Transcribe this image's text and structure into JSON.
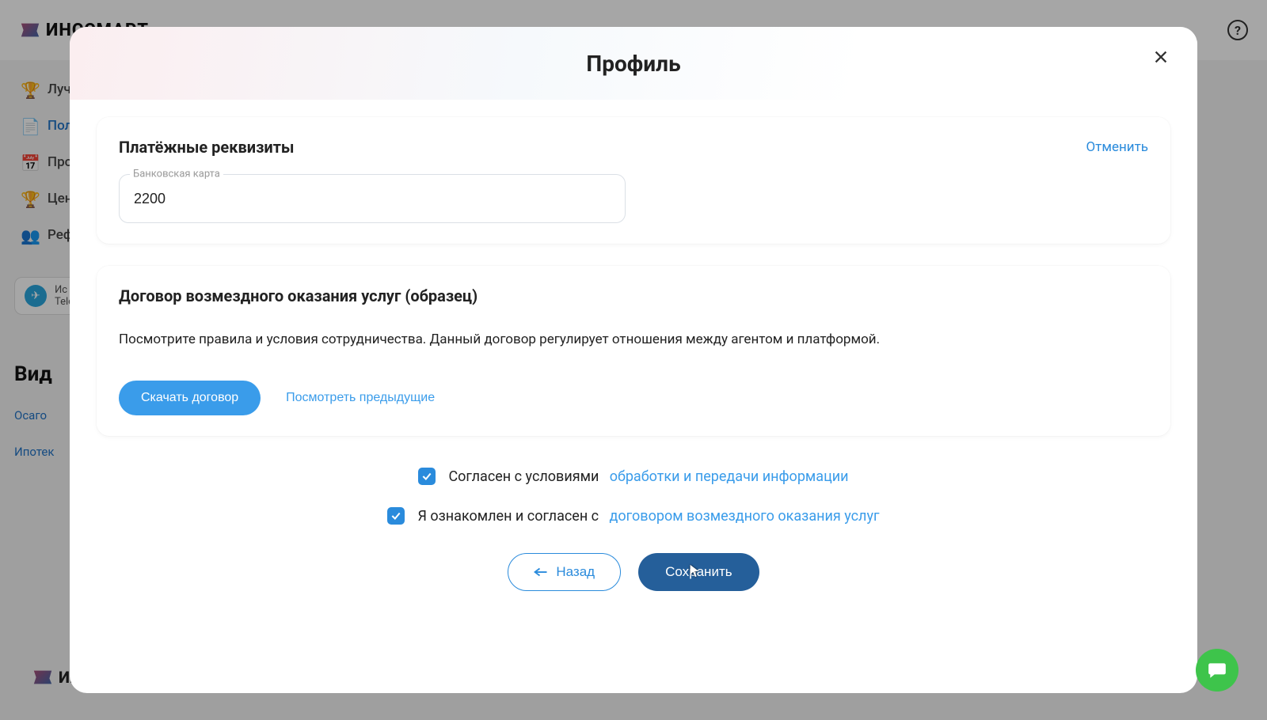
{
  "header": {
    "brand": "ИНССМАРТ"
  },
  "sidebar": {
    "items": [
      {
        "label": "Лучш"
      },
      {
        "label": "Пол"
      },
      {
        "label": "Про"
      },
      {
        "label": "Цен"
      },
      {
        "label": "Реф"
      }
    ],
    "tg_line1": "Ис",
    "tg_line2": "Tele",
    "heading": "Вид",
    "link1": "Осаго",
    "link2": "Ипотек"
  },
  "modal": {
    "title": "Профиль",
    "payment": {
      "title": "Платёжные реквизиты",
      "cancel": "Отменить",
      "input_label": "Банковская карта",
      "input_value": "2200"
    },
    "contract": {
      "title": "Договор возмездного оказания услуг (образец)",
      "desc": "Посмотрите правила и условия сотрудничества. Данный договор регулирует отношения между агентом и платформой.",
      "download": "Скачать договор",
      "view_prev": "Посмотреть предыдущие"
    },
    "agree1_text": "Согласен с условиями",
    "agree1_link": "обработки и передачи информации",
    "agree2_text": "Я ознакомлен и согласен с",
    "agree2_link": "договором возмездного оказания услуг",
    "back": "Назад",
    "save": "Сохранить"
  }
}
